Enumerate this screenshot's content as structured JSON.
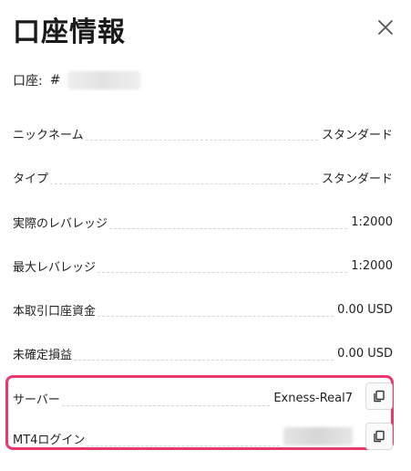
{
  "header": {
    "title": "口座情報",
    "close_icon": "close-icon"
  },
  "account": {
    "label": "口座:",
    "hash": "#"
  },
  "details": [
    {
      "label": "ニックネーム",
      "value": "スタンダード"
    },
    {
      "label": "タイプ",
      "value": "スタンダード"
    },
    {
      "label": "実際のレバレッジ",
      "value": "1:2000"
    },
    {
      "label": "最大レバレッジ",
      "value": "1:2000"
    },
    {
      "label": "本取引口座資金",
      "value": "0.00 USD"
    },
    {
      "label": "未確定損益",
      "value": "0.00 USD"
    }
  ],
  "server": {
    "label": "サーバー",
    "value": "Exness-Real7",
    "copy_icon": "copy-icon"
  },
  "login": {
    "label": "MT4ログイン",
    "copy_icon": "copy-icon"
  },
  "colors": {
    "highlight": "#e8386d",
    "text": "#1f1f1f",
    "divider": "#d6d6d6"
  }
}
